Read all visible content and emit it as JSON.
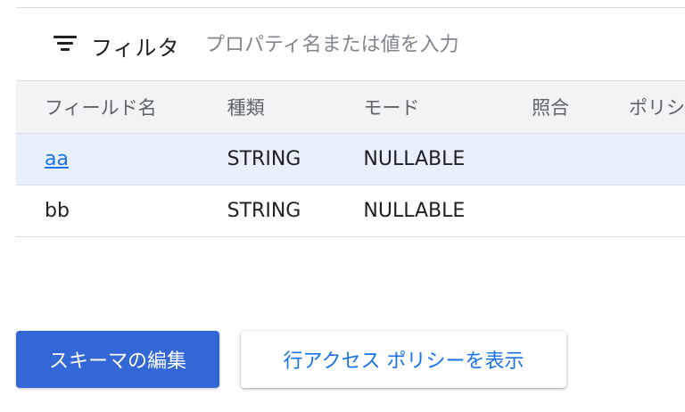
{
  "filter": {
    "icon": "filter-list-icon",
    "label": "フィルタ",
    "placeholder": "プロパティ名または値を入力"
  },
  "table": {
    "headers": {
      "field_name": "フィールド名",
      "type": "種類",
      "mode": "モード",
      "collation": "照合",
      "policy": "ポリシ"
    },
    "rows": [
      {
        "name": "aa",
        "type": "STRING",
        "mode": "NULLABLE",
        "collation": "",
        "policy": ""
      },
      {
        "name": "bb",
        "type": "STRING",
        "mode": "NULLABLE",
        "collation": "",
        "policy": ""
      }
    ]
  },
  "actions": {
    "edit_schema": "スキーマの編集",
    "view_row_access_policies": "行アクセス ポリシーを表示"
  },
  "colors": {
    "primary": "#3367d6",
    "link": "#1a73e8",
    "selected_row": "#e8f0fe",
    "header_bg": "#f1f3f4"
  }
}
